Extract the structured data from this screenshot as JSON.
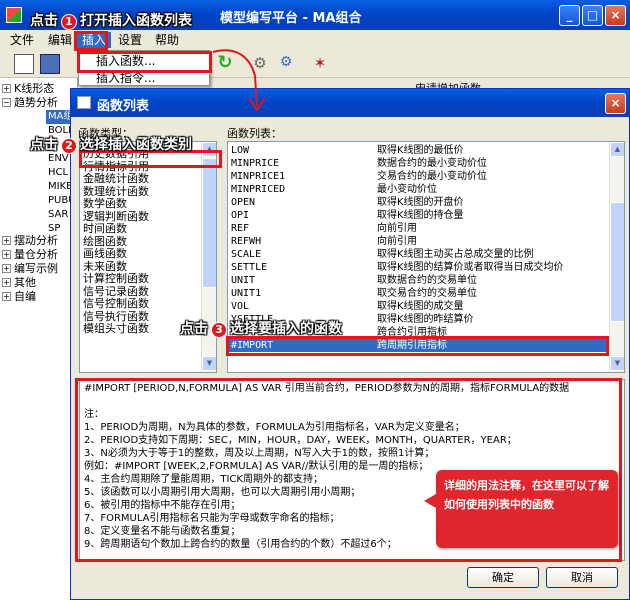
{
  "app": {
    "title": "模型编写平台 - MA组合"
  },
  "menu": {
    "file": "文件",
    "edit": "编辑",
    "insert": "插入",
    "settings": "设置",
    "help": "帮助"
  },
  "dropdown": {
    "insert_function": "插入函数...",
    "insert_command": "插入指令..."
  },
  "tree": {
    "kline": "K线形态",
    "trend": "趋势分析",
    "ma": "MA组",
    "sub": [
      "BOLL",
      "ENV",
      "HCL",
      "MIKE",
      "PUBU",
      "SAR",
      "SP"
    ],
    "swing": "摆动分析",
    "volume": "量仓分析",
    "editor": "编写示例",
    "other": "其他",
    "custom": "自编"
  },
  "behind_text": "申请增加函数",
  "dialog": {
    "title": "函数列表",
    "category_label": "函数类型：",
    "function_label": "函数列表：",
    "categories": [
      "历史数据引用",
      "行情指标引用",
      "金融统计函数",
      "数理统计函数",
      "数学函数",
      "逻辑判断函数",
      "时间函数",
      "绘图函数",
      "画线函数",
      "未来函数",
      "计算控制函数",
      "信号记录函数",
      "信号控制函数",
      "信号执行函数",
      "模组头寸函数"
    ],
    "functions": [
      {
        "name": "LOW",
        "desc": "取得K线图的最低价"
      },
      {
        "name": "MINPRICE",
        "desc": "数据合约的最小变动价位"
      },
      {
        "name": "MINPRICE1",
        "desc": "交易合约的最小变动价位"
      },
      {
        "name": "MINPRICED",
        "desc": "最小变动价位"
      },
      {
        "name": "OPEN",
        "desc": "取得K线图的开盘价"
      },
      {
        "name": "OPI",
        "desc": "取得K线图的持仓量"
      },
      {
        "name": "REF",
        "desc": "向前引用"
      },
      {
        "name": "REFWH",
        "desc": "向前引用"
      },
      {
        "name": "SCALE",
        "desc": "取得K线图主动买占总成交量的比例"
      },
      {
        "name": "SETTLE",
        "desc": "取得K线图的结算价或者取得当日成交均价"
      },
      {
        "name": "UNIT",
        "desc": "取数据合约的交易单位"
      },
      {
        "name": "UNIT1",
        "desc": "取交易合约的交易单位"
      },
      {
        "name": "VOL",
        "desc": "取得K线图的成交量"
      },
      {
        "name": "YSETTLE",
        "desc": "取得K线图的昨结算价"
      },
      {
        "name": "",
        "desc": "跨合约引用指标"
      },
      {
        "name": "#IMPORT",
        "desc": "跨周期引用指标"
      }
    ],
    "description": [
      "#IMPORT [PERIOD,N,FORMULA] AS VAR 引用当前合约，PERIOD参数为N的周期，指标FORMULA的数据",
      "",
      "注：",
      "1、PERIOD为周期，N为具体的参数，FORMULA为引用指标名，VAR为定义变量名；",
      "2、PERIOD支持如下周期：SEC，MIN，HOUR，DAY，WEEK，MONTH，QUARTER，YEAR；",
      "3、N必须为大于等于1的整数，周及以上周期，N写入大于1的数，按照1计算；",
      "例如：#IMPORT [WEEK,2,FORMULA] AS VAR//默认引用的是一周的指标；",
      "4、主合约周期除了量能周期，TICK周期外的都支持；",
      "5、该函数可以小周期引用大周期，也可以大周期引用小周期；",
      "6、被引用的指标中不能存在引用；",
      "7、FORMULA引用指标名只能为字母或数字命名的指标；",
      "8、定义变量名不能与函数名重复；",
      "9、跨周期语句个数加上跨合约的数量（引用合约的个数）不超过6个；"
    ],
    "ok": "确定",
    "cancel": "取消"
  },
  "annotations": {
    "step1": {
      "prefix": "点击",
      "num": "1",
      "text": "打开插入函数列表"
    },
    "step2": {
      "prefix": "点击",
      "num": "2",
      "text": "选择插入函数类别"
    },
    "step3": {
      "prefix": "点击",
      "num": "3",
      "text": "选择要插入的函数"
    },
    "callout": "详细的用法注释，在这里可以了解如何使用列表中的函数"
  },
  "colors": {
    "title_blue": "#0046c8",
    "selection": "#316ac5",
    "annotation_red": "#e3161c"
  }
}
